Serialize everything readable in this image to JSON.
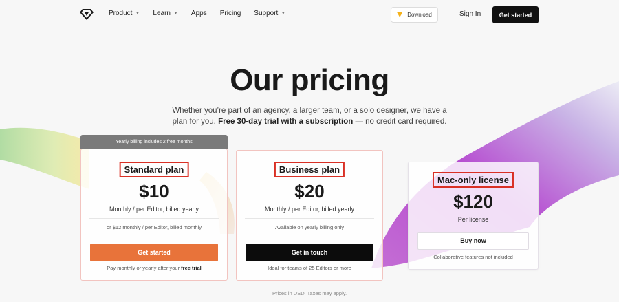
{
  "nav": {
    "items": [
      {
        "label": "Product",
        "dropdown": true
      },
      {
        "label": "Learn",
        "dropdown": true
      },
      {
        "label": "Apps",
        "dropdown": false
      },
      {
        "label": "Pricing",
        "dropdown": false
      },
      {
        "label": "Support",
        "dropdown": true
      }
    ],
    "download_label": "Download",
    "signin_label": "Sign In",
    "getstarted_label": "Get started",
    "logo_icon": "diamond-logo-icon",
    "download_icon": "sketch-diamond-icon"
  },
  "hero": {
    "title": "Our pricing",
    "subtitle_plain": "Whether you’re part of an agency, a larger team, or a solo designer, we have a plan for you.",
    "subtitle_bold": "Free 30-day trial with a subscription",
    "subtitle_tail": " — no credit card required."
  },
  "plans": [
    {
      "ribbon": "Yearly billing includes 2 free months",
      "name": "Standard plan",
      "price": "$10",
      "billing": "Monthly / per Editor, billed yearly",
      "alt": "or $12 monthly / per Editor, billed monthly",
      "button": "Get started",
      "note_plain": "Pay monthly or yearly after your ",
      "note_bold": "free trial"
    },
    {
      "name": "Business plan",
      "price": "$20",
      "billing": "Monthly / per Editor, billed yearly",
      "alt": "Available on yearly billing only",
      "button": "Get in touch",
      "note": "Ideal for teams of 25 Editors or more"
    },
    {
      "name": "Mac-only license",
      "price": "$120",
      "billing": "Per license",
      "button": "Buy now",
      "note": "Collaborative features not included"
    }
  ],
  "footer": {
    "note": "Prices in USD. Taxes may apply."
  },
  "colors": {
    "accent_orange": "#e8733a",
    "highlight_red": "#d93025",
    "dark_button": "#0c0c0c"
  }
}
